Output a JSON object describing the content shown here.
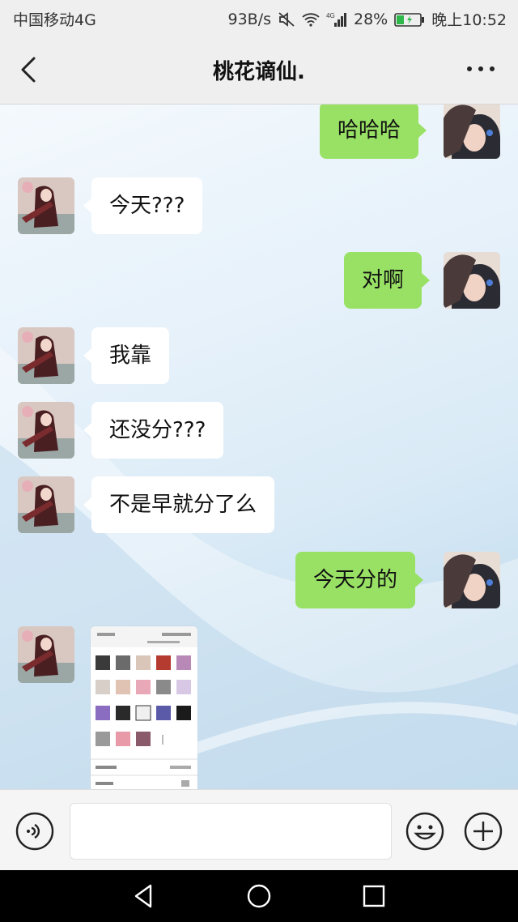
{
  "status_bar": {
    "carrier": "中国移动4G",
    "net_speed": "93B/s",
    "battery": "28%",
    "time": "晚上10:52"
  },
  "header": {
    "title": "桃花谪仙."
  },
  "messages": [
    {
      "side": "me",
      "text": "哈哈哈"
    },
    {
      "side": "other",
      "text": "今天???"
    },
    {
      "side": "me",
      "text": "对啊"
    },
    {
      "side": "other",
      "text": "我靠"
    },
    {
      "side": "other",
      "text": "还没分???"
    },
    {
      "side": "other",
      "text": "不是早就分了么"
    },
    {
      "side": "me",
      "text": "今天分的"
    },
    {
      "side": "other",
      "type": "image"
    }
  ],
  "colors": {
    "my_bubble": "#98e165",
    "other_bubble": "#ffffff",
    "header_bg": "#efefef"
  },
  "icons": [
    "back-icon",
    "more-icon",
    "voice-icon",
    "emoji-icon",
    "plus-icon",
    "nav-back-icon",
    "nav-home-icon",
    "nav-recent-icon"
  ]
}
